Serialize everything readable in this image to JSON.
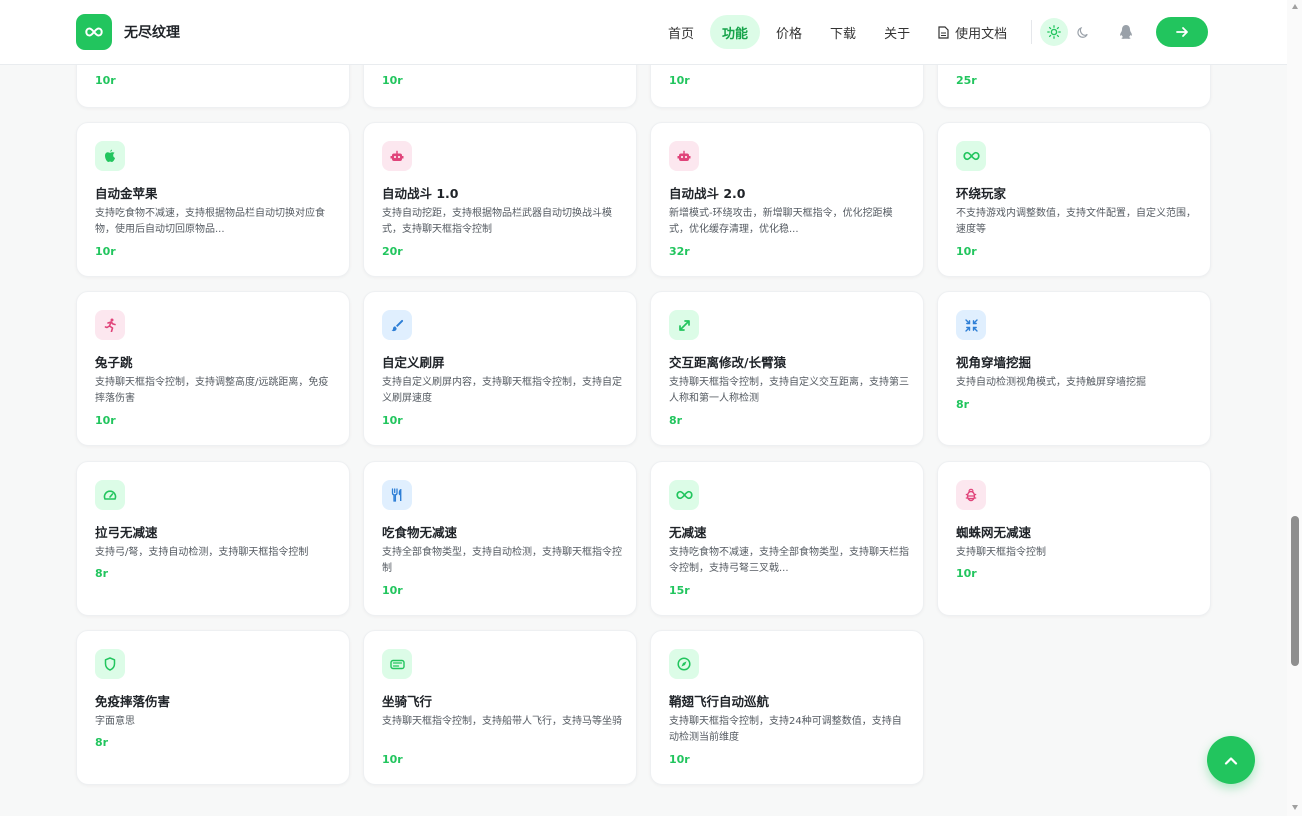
{
  "brand": {
    "name": "无尽纹理",
    "logo_icon": "infinity-icon",
    "accent": "#22c55e"
  },
  "nav": {
    "items": [
      "首页",
      "功能",
      "价格",
      "下载",
      "关于"
    ],
    "active": "功能",
    "docs_label": "使用文档",
    "theme": "light"
  },
  "top_partial_prices": [
    "10r",
    "10r",
    "10r",
    "25r"
  ],
  "cards": [
    {
      "title": "自动金苹果",
      "desc": "支持吃食物不减速，支持根据物品栏自动切换对应食物，使用后自动切回原物品...",
      "price": "10r",
      "icon": "apple-icon",
      "color": "green"
    },
    {
      "title": "自动战斗 1.0",
      "desc": "支持自动挖距，支持根据物品栏武器自动切换战斗模式，支持聊天框指令控制",
      "price": "20r",
      "icon": "robot-icon",
      "color": "pink"
    },
    {
      "title": "自动战斗 2.0",
      "desc": "新增模式-环绕攻击，新增聊天框指令，优化挖距模式，优化缓存清理，优化稳...",
      "price": "32r",
      "icon": "robot-icon",
      "color": "pink"
    },
    {
      "title": "环绕玩家",
      "desc": "不支持游戏内调整数值，支持文件配置，自定义范围，速度等",
      "price": "10r",
      "icon": "infinity-icon",
      "color": "green"
    },
    {
      "title": "兔子跳",
      "desc": "支持聊天框指令控制，支持调整高度/远跳距离，免疫摔落伤害",
      "price": "10r",
      "icon": "running-icon",
      "color": "pink"
    },
    {
      "title": "自定义刷屏",
      "desc": "支持自定义刷屏内容，支持聊天框指令控制，支持自定义刷屏速度",
      "price": "10r",
      "icon": "brush-icon",
      "color": "blue"
    },
    {
      "title": "交互距离修改/长臂猿",
      "desc": "支持聊天框指令控制，支持自定义交互距离，支持第三人称和第一人称检测",
      "price": "8r",
      "icon": "expand-icon",
      "color": "green"
    },
    {
      "title": "视角穿墙挖掘",
      "desc": "支持自动检测视角模式，支持触屏穿墙挖掘",
      "price": "8r",
      "icon": "compress-icon",
      "color": "blue"
    },
    {
      "title": "拉弓无减速",
      "desc": "支持弓/弩，支持自动检测，支持聊天框指令控制",
      "price": "8r",
      "icon": "gauge-icon",
      "color": "green"
    },
    {
      "title": "吃食物无减速",
      "desc": "支持全部食物类型，支持自动检测，支持聊天框指令控制",
      "price": "10r",
      "icon": "utensils-icon",
      "color": "blue"
    },
    {
      "title": "无减速",
      "desc": "支持吃食物不减速，支持全部食物类型，支持聊天栏指令控制，支持弓弩三叉戟...",
      "price": "15r",
      "icon": "infinity-icon",
      "color": "green"
    },
    {
      "title": "蜘蛛网无减速",
      "desc": "支持聊天框指令控制",
      "price": "10r",
      "icon": "bug-icon",
      "color": "pink"
    },
    {
      "title": "免疫摔落伤害",
      "desc": "字面意思",
      "price": "8r",
      "icon": "shield-icon",
      "color": "green"
    },
    {
      "title": "坐骑飞行",
      "desc": "支持聊天框指令控制，支持船带人飞行，支持马等坐骑",
      "price": "10r",
      "icon": "horse-icon",
      "color": "green"
    },
    {
      "title": "鞘翅飞行自动巡航",
      "desc": "支持聊天框指令控制，支持24种可调整数值，支持自动检测当前维度",
      "price": "10r",
      "icon": "compass-icon",
      "color": "green"
    }
  ],
  "colors": {
    "green": "#22c55e",
    "pink": "#e0447a",
    "blue": "#2e7fd6"
  }
}
